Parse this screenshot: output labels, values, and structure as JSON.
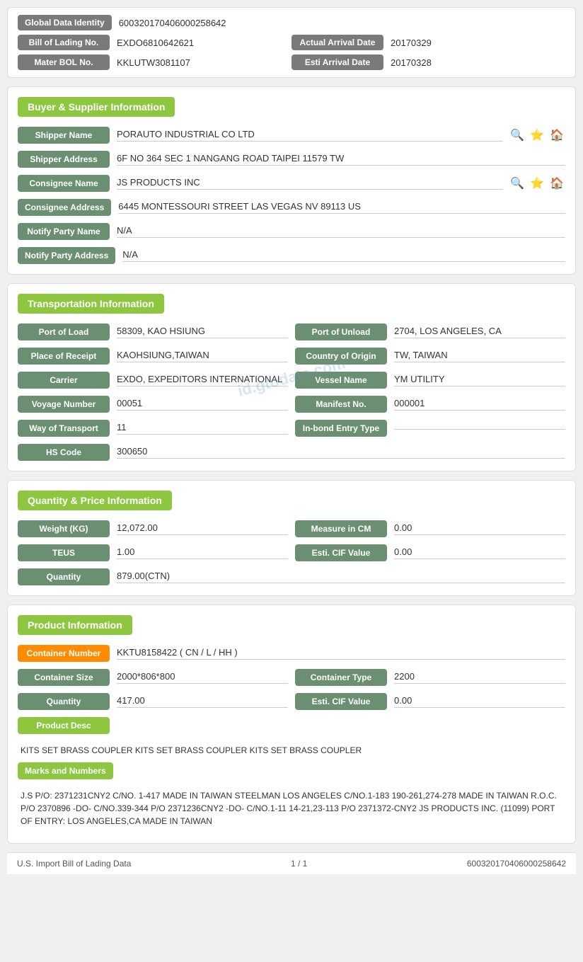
{
  "identity": {
    "global_label": "Global Data Identity",
    "global_value": "600320170406000258642",
    "bol_label": "Bill of Lading No.",
    "bol_value": "EXDO6810642621",
    "actual_arrival_label": "Actual Arrival Date",
    "actual_arrival_value": "20170329",
    "mater_bol_label": "Mater BOL No.",
    "mater_bol_value": "KKLUTW3081107",
    "esti_arrival_label": "Esti Arrival Date",
    "esti_arrival_value": "20170328"
  },
  "buyer_supplier": {
    "section_title": "Buyer & Supplier Information",
    "shipper_name_label": "Shipper Name",
    "shipper_name_value": "PORAUTO INDUSTRIAL CO LTD",
    "shipper_address_label": "Shipper Address",
    "shipper_address_value": "6F NO 364 SEC 1 NANGANG ROAD TAIPEI 11579 TW",
    "consignee_name_label": "Consignee Name",
    "consignee_name_value": "JS PRODUCTS INC",
    "consignee_address_label": "Consignee Address",
    "consignee_address_value": "6445 MONTESSOURI STREET LAS VEGAS NV 89113 US",
    "notify_party_name_label": "Notify Party Name",
    "notify_party_name_value": "N/A",
    "notify_party_address_label": "Notify Party Address",
    "notify_party_address_value": "N/A"
  },
  "transportation": {
    "section_title": "Transportation Information",
    "port_of_load_label": "Port of Load",
    "port_of_load_value": "58309, KAO HSIUNG",
    "port_of_unload_label": "Port of Unload",
    "port_of_unload_value": "2704, LOS ANGELES, CA",
    "place_of_receipt_label": "Place of Receipt",
    "place_of_receipt_value": "KAOHSIUNG,TAIWAN",
    "country_of_origin_label": "Country of Origin",
    "country_of_origin_value": "TW, TAIWAN",
    "carrier_label": "Carrier",
    "carrier_value": "EXDO, EXPEDITORS INTERNATIONAL",
    "vessel_name_label": "Vessel Name",
    "vessel_name_value": "YM UTILITY",
    "voyage_number_label": "Voyage Number",
    "voyage_number_value": "00051",
    "manifest_no_label": "Manifest No.",
    "manifest_no_value": "000001",
    "way_of_transport_label": "Way of Transport",
    "way_of_transport_value": "11",
    "in_bond_label": "In-bond Entry Type",
    "in_bond_value": "",
    "hs_code_label": "HS Code",
    "hs_code_value": "300650"
  },
  "quantity_price": {
    "section_title": "Quantity & Price Information",
    "weight_label": "Weight (KG)",
    "weight_value": "12,072.00",
    "measure_label": "Measure in CM",
    "measure_value": "0.00",
    "teus_label": "TEUS",
    "teus_value": "1.00",
    "esti_cif_label": "Esti. CIF Value",
    "esti_cif_value": "0.00",
    "quantity_label": "Quantity",
    "quantity_value": "879.00(CTN)"
  },
  "product": {
    "section_title": "Product Information",
    "container_number_label": "Container Number",
    "container_number_value": "KKTU8158422 ( CN / L / HH )",
    "container_size_label": "Container Size",
    "container_size_value": "2000*806*800",
    "container_type_label": "Container Type",
    "container_type_value": "2200",
    "quantity_label": "Quantity",
    "quantity_value": "417.00",
    "esti_cif_label": "Esti. CIF Value",
    "esti_cif_value": "0.00",
    "product_desc_label": "Product Desc",
    "product_desc_text": "KITS SET BRASS COUPLER KITS SET BRASS COUPLER KITS SET BRASS COUPLER",
    "marks_label": "Marks and Numbers",
    "marks_text": "J.S P/O: 2371231CNY2 C/NO. 1-417 MADE IN TAIWAN STEELMAN LOS ANGELES C/NO.1-183 190-261,274-278 MADE IN TAIWAN R.O.C. P/O 2370896 -DO- C/NO.339-344 P/O 2371236CNY2 -DO- C/NO.1-11 14-21,23-113 P/O 2371372-CNY2 JS PRODUCTS INC. (11099) PORT OF ENTRY: LOS ANGELES,CA MADE IN TAIWAN"
  },
  "footer": {
    "left_text": "U.S. Import Bill of Lading Data",
    "center_text": "1 / 1",
    "right_text": "600320170406000258642"
  },
  "watermark": "id.gtodata.com",
  "icons": {
    "search": "🔍",
    "star": "⭐",
    "home": "🏠"
  }
}
